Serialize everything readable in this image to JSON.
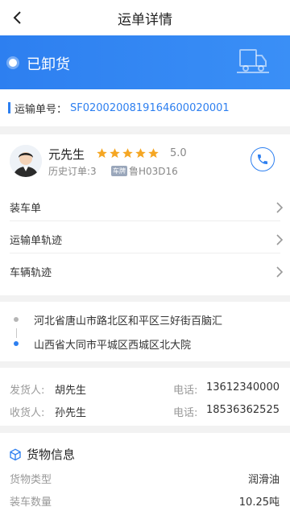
{
  "header": {
    "title": "运单详情"
  },
  "status": {
    "text": "已卸货"
  },
  "waybill": {
    "label": "运输单号：",
    "number": "SF020020081916460002000​1"
  },
  "driver": {
    "name": "元先生",
    "rating": 5,
    "rating_text": "5.0",
    "history": "历史订单:3",
    "plate_tag": "车牌",
    "plate": "鲁H03D16"
  },
  "menu": [
    {
      "label": "装车单"
    },
    {
      "label": "运输单轨迹"
    },
    {
      "label": "车辆轨迹"
    }
  ],
  "route": {
    "from": "河北省唐山市路北区和平区三好街百脑汇",
    "to": "山西省大同市平城区西城区北大院"
  },
  "contacts": {
    "shipper_label": "发货人:",
    "shipper_name": "胡先生",
    "shipper_phone_label": "电话:",
    "shipper_phone": "13612340000",
    "receiver_label": "收货人:",
    "receiver_name": "孙先生",
    "receiver_phone_label": "电话:",
    "receiver_phone": "18536362525"
  },
  "goods": {
    "title": "货物信息",
    "type_label": "货物类型",
    "type_value": "润滑油",
    "qty_label": "装车数量",
    "qty_value": "10.25吨"
  },
  "colors": {
    "accent": "#2d7ff0",
    "star": "#f5a623"
  }
}
